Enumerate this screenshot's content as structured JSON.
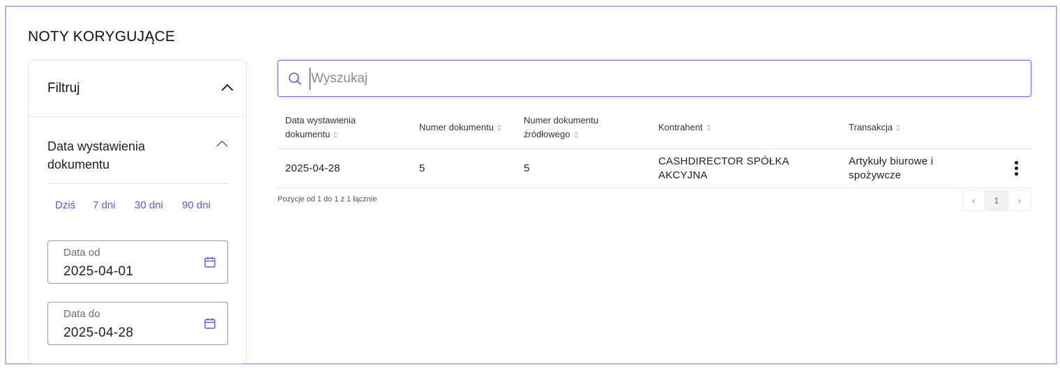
{
  "page": {
    "title": "NOTY KORYGUJĄCE"
  },
  "filter": {
    "title": "Filtruj",
    "section_title": "Data wystawienia dokumentu",
    "quick_ranges": [
      "Dziś",
      "7 dni",
      "30 dni",
      "90 dni"
    ],
    "date_from": {
      "label": "Data od",
      "value": "2025-04-01"
    },
    "date_to": {
      "label": "Data do",
      "value": "2025-04-28"
    }
  },
  "search": {
    "placeholder": "Wyszukaj",
    "value": ""
  },
  "table": {
    "columns": [
      {
        "line1": "Data wystawienia",
        "line2": "dokumentu"
      },
      {
        "line1": "Numer dokumentu",
        "line2": ""
      },
      {
        "line1": "Numer dokumentu",
        "line2": "źródłowego"
      },
      {
        "line1": "Kontrahent",
        "line2": ""
      },
      {
        "line1": "Transakcja",
        "line2": ""
      }
    ],
    "rows": [
      {
        "date": "2025-04-28",
        "doc_number": "5",
        "source_doc_number": "5",
        "contractor_line1": "CASHDIRECTOR SPÓŁKA",
        "contractor_line2": "AKCYJNA",
        "transaction_line1": "Artykuły biurowe i",
        "transaction_line2": "spożywcze"
      }
    ]
  },
  "pagination": {
    "info": "Pozycje od 1 do 1 z 1 łącznie",
    "current_page": "1",
    "prev_label": "‹",
    "next_label": "›"
  },
  "colors": {
    "accent": "#6a4fd6",
    "frame_border": "#b7b0ec"
  },
  "icons": {
    "search": "search-icon",
    "calendar": "calendar-icon",
    "sort": "sort-icon",
    "more": "kebab-menu-icon"
  }
}
